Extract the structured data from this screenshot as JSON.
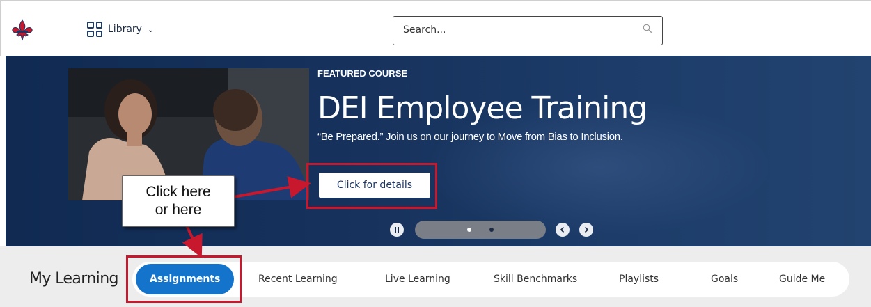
{
  "header": {
    "library_label": "Library",
    "search_placeholder": "Search..."
  },
  "hero": {
    "eyebrow": "FEATURED COURSE",
    "title": "DEI Employee Training",
    "subtitle": "“Be Prepared.” Join us on our journey to Move from Bias to Inclusion.",
    "cta_label": "Click for details",
    "carousel": {
      "slides": 2,
      "active_slide": 1
    }
  },
  "annotation": {
    "callout_line1": "Click here",
    "callout_line2": "or here",
    "highlight_color": "#c8182e"
  },
  "my_learning": {
    "title": "My Learning",
    "tabs": [
      {
        "label": "Assignments",
        "active": true
      },
      {
        "label": "Recent Learning",
        "active": false
      },
      {
        "label": "Live Learning",
        "active": false
      },
      {
        "label": "Skill Benchmarks",
        "active": false
      },
      {
        "label": "Playlists",
        "active": false
      },
      {
        "label": "Goals",
        "active": false
      },
      {
        "label": "Guide Me",
        "active": false
      }
    ]
  },
  "colors": {
    "brand_navy": "#1b3564",
    "active_tab": "#1474cc",
    "hero_bg": "#17335e"
  },
  "icons": [
    "fleur-de-lis-logo-icon",
    "grid-icon",
    "chevron-down-icon",
    "search-icon",
    "pause-icon",
    "chevron-left-icon",
    "chevron-right-icon"
  ]
}
